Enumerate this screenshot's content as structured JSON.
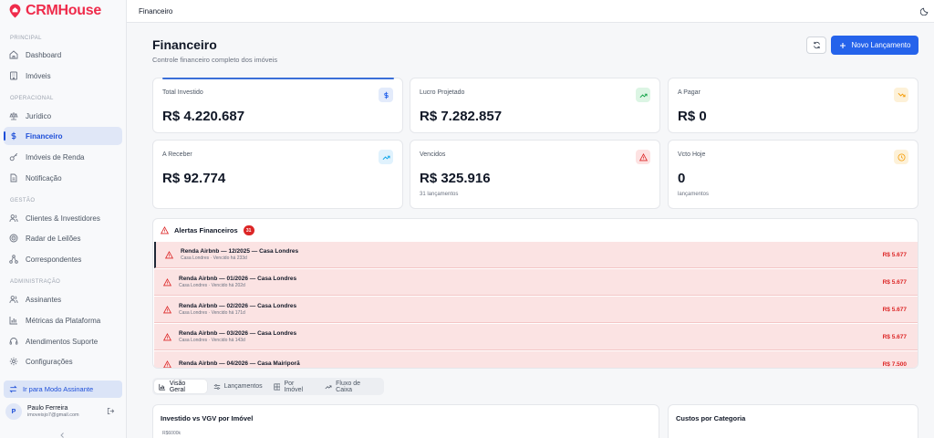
{
  "brand": {
    "name": "CRMHouse",
    "accent": "#ef2b4b"
  },
  "sidebar": {
    "sections": [
      {
        "label": "PRINCIPAL"
      },
      {
        "label": "OPERACIONAL"
      },
      {
        "label": "GESTÃO"
      },
      {
        "label": "ADMINISTRAÇÃO"
      }
    ],
    "items": [
      {
        "label": "Dashboard",
        "icon": "home-icon"
      },
      {
        "label": "Imóveis",
        "icon": "building-icon"
      },
      {
        "label": "Jurídico",
        "icon": "scale-icon"
      },
      {
        "label": "Financeiro",
        "icon": "dollar-icon",
        "active": true
      },
      {
        "label": "Imóveis de Renda",
        "icon": "key-icon"
      },
      {
        "label": "Notificação",
        "icon": "file-icon"
      },
      {
        "label": "Clientes & Investidores",
        "icon": "users-icon"
      },
      {
        "label": "Radar de Leilões",
        "icon": "radar-icon"
      },
      {
        "label": "Correspondentes",
        "icon": "network-icon"
      },
      {
        "label": "Assinantes",
        "icon": "users-icon"
      },
      {
        "label": "Métricas da Plataforma",
        "icon": "bar-chart-icon"
      },
      {
        "label": "Atendimentos Suporte",
        "icon": "headset-icon"
      },
      {
        "label": "Configurações",
        "icon": "gear-icon"
      }
    ],
    "mode_button": "Ir para Modo Assinante",
    "user": {
      "initial": "P",
      "name": "Paulo Ferreira",
      "email": "imoveisjo7@gmail.com"
    }
  },
  "topbar": {
    "breadcrumb": "Financeiro"
  },
  "header": {
    "title": "Financeiro",
    "subtitle": "Controle financeiro completo dos imóveis",
    "new_button": "Novo Lançamento"
  },
  "cards": [
    {
      "label": "Total Investido",
      "value": "R$ 4.220.687",
      "sub": ""
    },
    {
      "label": "Lucro Projetado",
      "value": "R$ 7.282.857",
      "sub": ""
    },
    {
      "label": "A Pagar",
      "value": "R$ 0",
      "sub": ""
    },
    {
      "label": "A Receber",
      "value": "R$ 92.774",
      "sub": ""
    },
    {
      "label": "Vencidos",
      "value": "R$ 325.916",
      "sub": "31 lançamentos"
    },
    {
      "label": "Vcto Hoje",
      "value": "0",
      "sub": "lançamentos"
    }
  ],
  "alerts": {
    "title": "Alertas Financeiros",
    "count": "31",
    "items": [
      {
        "title": "Renda Airbnb — 12/2025 — Casa Londres",
        "meta": "Casa Londres · Vencido há 233d",
        "amount": "R$ 5.677"
      },
      {
        "title": "Renda Airbnb — 01/2026 — Casa Londres",
        "meta": "Casa Londres · Vencido há 202d",
        "amount": "R$ 5.677"
      },
      {
        "title": "Renda Airbnb — 02/2026 — Casa Londres",
        "meta": "Casa Londres · Vencido há 171d",
        "amount": "R$ 5.677"
      },
      {
        "title": "Renda Airbnb — 03/2026 — Casa Londres",
        "meta": "Casa Londres · Vencido há 143d",
        "amount": "R$ 5.677"
      },
      {
        "title": "Renda Airbnb — 04/2026 — Casa Mairiporã",
        "meta": "",
        "amount": "R$ 7.500"
      }
    ]
  },
  "tabs": [
    {
      "label": "Visão Geral",
      "icon": "bar-chart-icon",
      "active": true
    },
    {
      "label": "Lançamentos",
      "icon": "sliders-icon"
    },
    {
      "label": "Por Imóvel",
      "icon": "grid-icon"
    },
    {
      "label": "Fluxo de Caixa",
      "icon": "trend-icon"
    }
  ],
  "panels": {
    "left_title": "Investido vs VGV por Imóvel",
    "left_ytick": "R$6000k",
    "right_title": "Custos por Categoria"
  },
  "colors": {
    "primary": "#2563eb",
    "danger": "#dc2626",
    "success": "#16a34a",
    "warning": "#f59e0b",
    "info": "#0ea5e9"
  }
}
